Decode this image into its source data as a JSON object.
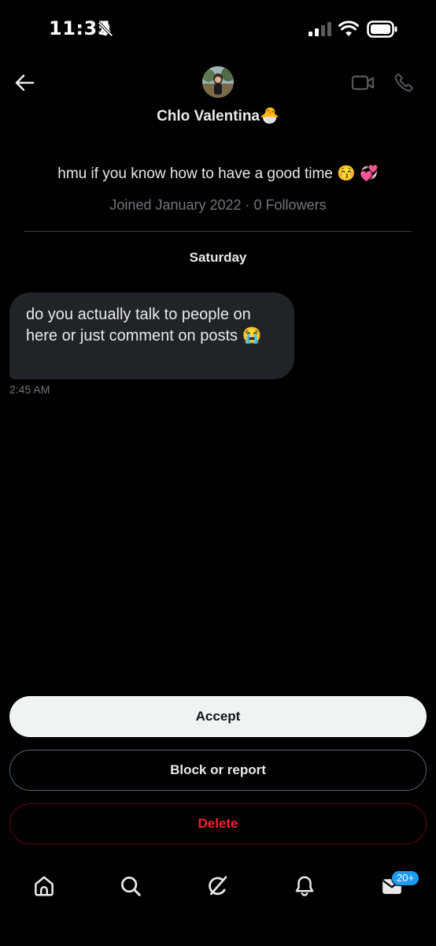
{
  "status_bar": {
    "time": "11:35"
  },
  "header": {
    "name": "Chlo Valentina",
    "name_emoji": "🐣",
    "bio": "hmu if you know how to have a good time 😚 💞",
    "meta": "Joined January 2022 · 0 Followers"
  },
  "conversation": {
    "day_label": "Saturday",
    "messages": [
      {
        "text": "do you actually talk to people on here or just comment on posts 😭",
        "time": "2:45 AM"
      }
    ]
  },
  "actions": {
    "accept": "Accept",
    "block_or_report": "Block or report",
    "delete": "Delete"
  },
  "nav": {
    "messages_badge": "20+",
    "icons": [
      "home-icon",
      "search-icon",
      "grok-icon",
      "notifications-icon",
      "messages-icon"
    ]
  },
  "colors": {
    "background": "#000000",
    "accent": "#1d9bf0",
    "danger": "#f4212e",
    "bubble": "#202327",
    "muted_text": "#71767b"
  }
}
